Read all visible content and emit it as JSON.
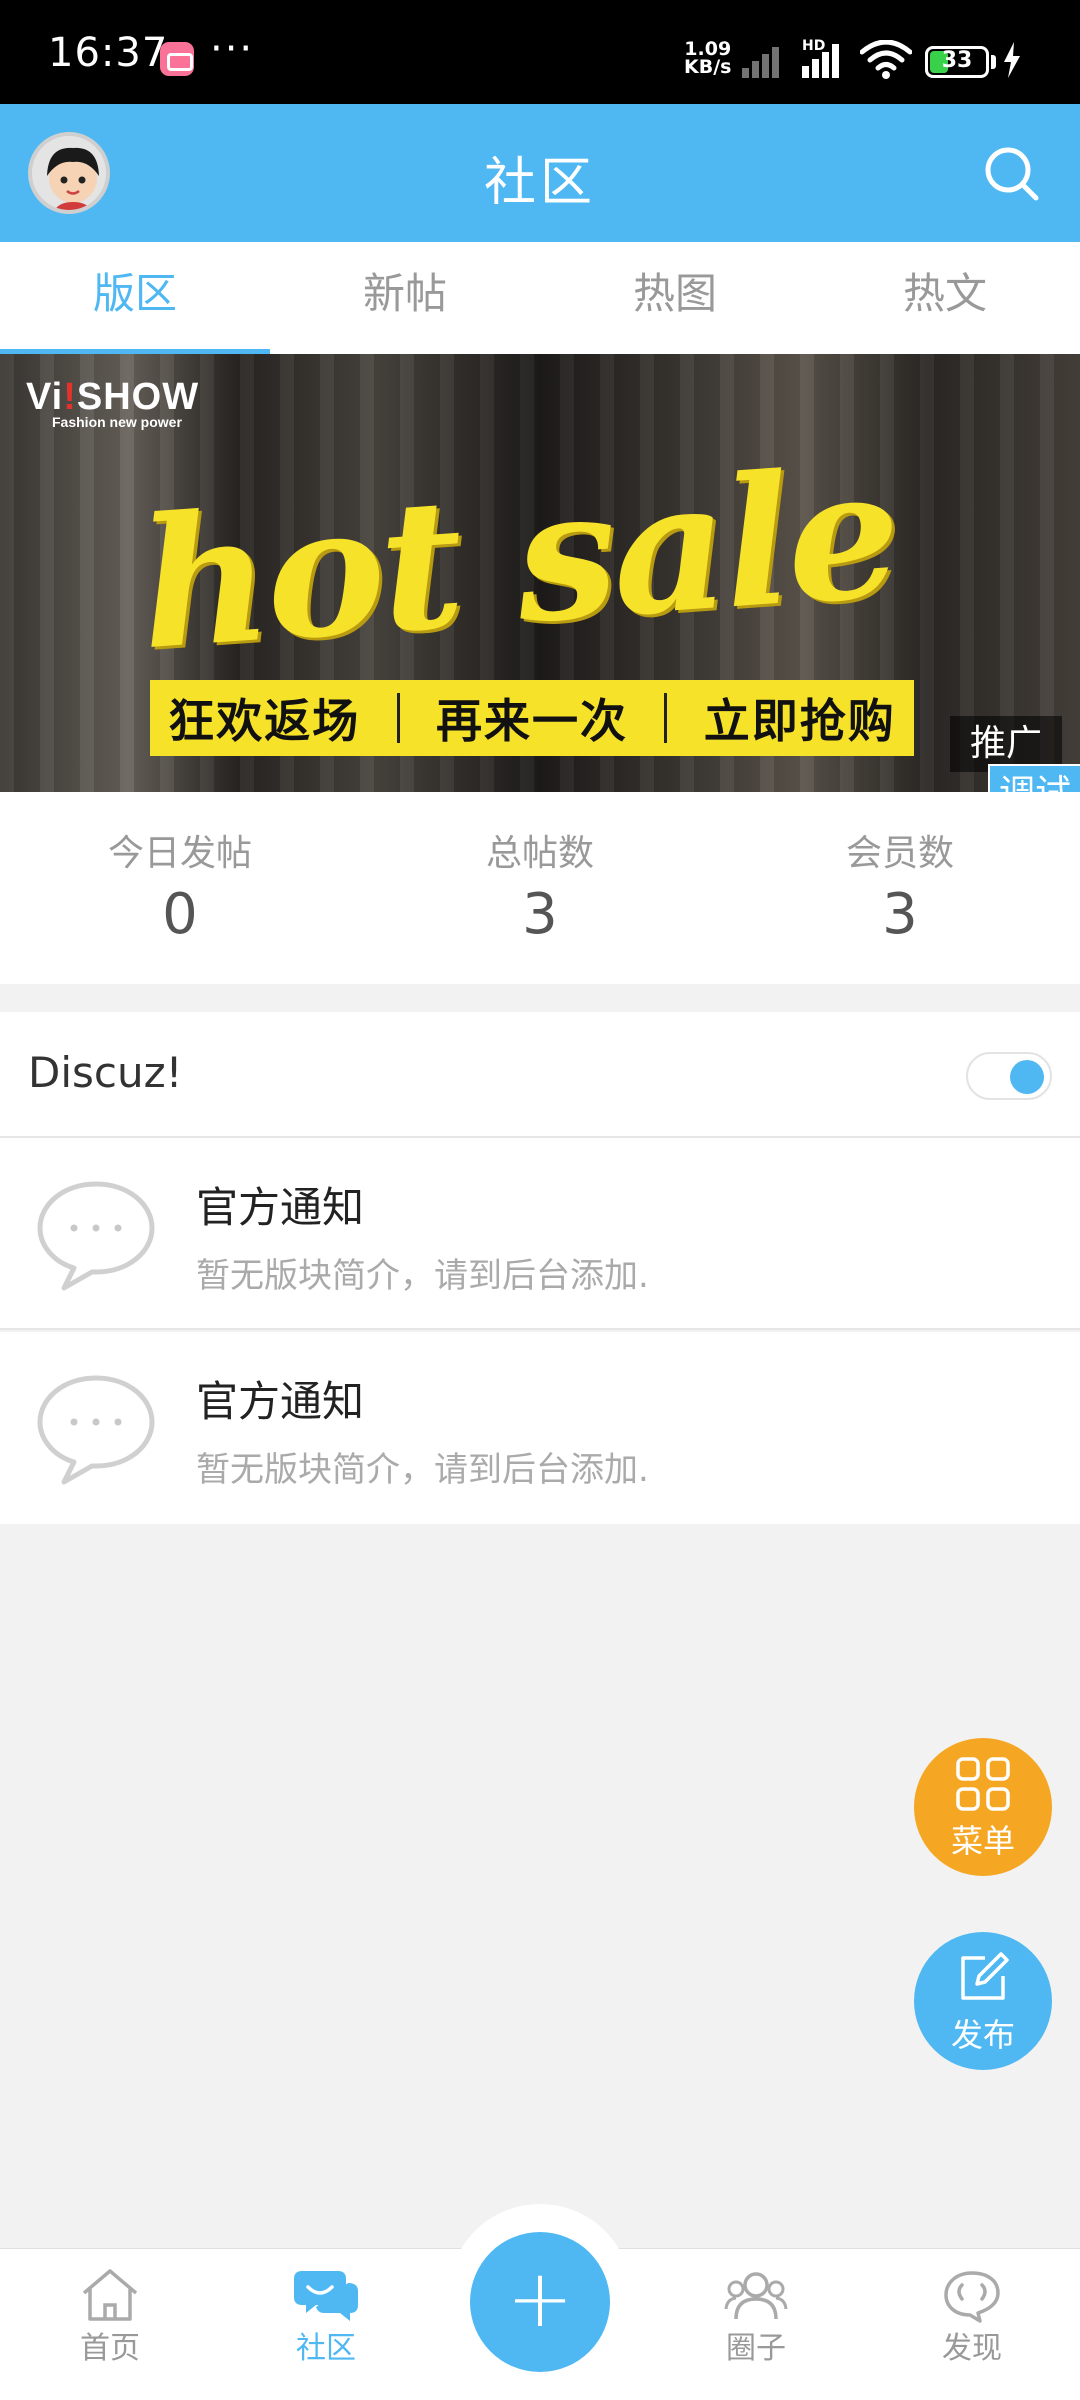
{
  "status_bar": {
    "time": "16:37",
    "more": "···",
    "speed_value": "1.09",
    "speed_unit": "KB/s",
    "network": "HD",
    "battery": "33",
    "battery_level": 0.33
  },
  "header": {
    "title": "社区",
    "avatar_icon": "avatar-icon",
    "search_icon": "search-icon"
  },
  "tabs": [
    {
      "label": "版区",
      "active": true
    },
    {
      "label": "新帖",
      "active": false
    },
    {
      "label": "热图",
      "active": false
    },
    {
      "label": "热文",
      "active": false
    }
  ],
  "banner": {
    "brand_prefix": "Vi",
    "brand_i": "!",
    "brand_suffix": "SHOW",
    "tagline": "Fashion new power",
    "headline": "hot sale",
    "strip": [
      "狂欢返场",
      "再来一次",
      "立即抢购"
    ],
    "promo_badge": "推广",
    "debug_badge": "调试"
  },
  "stats": [
    {
      "label": "今日发帖",
      "value": "0"
    },
    {
      "label": "总帖数",
      "value": "3"
    },
    {
      "label": "会员数",
      "value": "3"
    }
  ],
  "section": {
    "title": "Discuz!",
    "toggle_on": true
  },
  "forums": [
    {
      "name": "官方通知",
      "description": "暂无版块简介，请到后台添加."
    },
    {
      "name": "官方通知",
      "description": "暂无版块简介，请到后台添加."
    }
  ],
  "fab": {
    "menu_label": "菜单",
    "post_label": "发布"
  },
  "bottom_nav": {
    "home": "首页",
    "community": "社区",
    "add": "+",
    "circle": "圈子",
    "discover": "发现"
  },
  "colors": {
    "accent": "#4fb8f3",
    "menu_fab": "#f5a623",
    "banner_yellow": "#f7e22a"
  }
}
